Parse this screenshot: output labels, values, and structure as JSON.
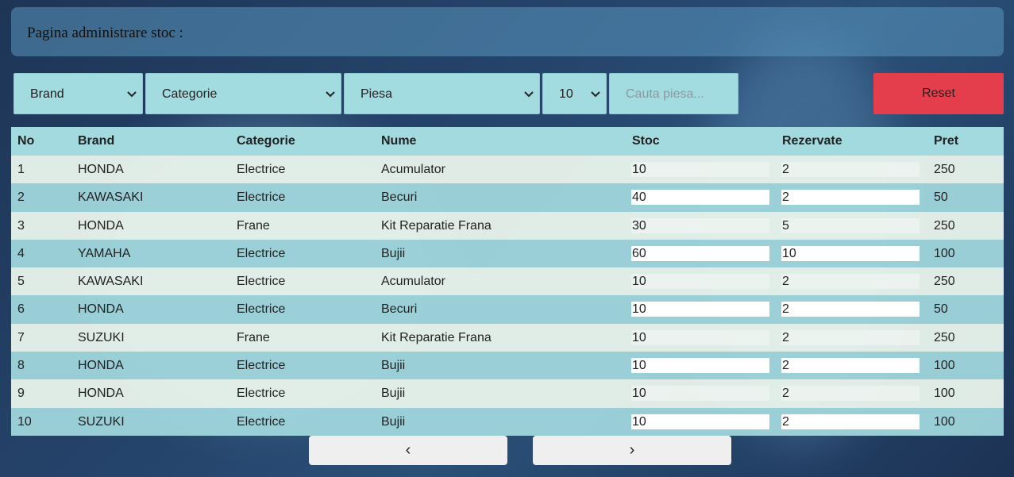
{
  "header": {
    "title": "Pagina administrare stoc :"
  },
  "filters": {
    "brand": "Brand",
    "categorie": "Categorie",
    "piesa": "Piesa",
    "per_page": "10",
    "search_placeholder": "Cauta piesa...",
    "reset_label": "Reset"
  },
  "table": {
    "columns": [
      "No",
      "Brand",
      "Categorie",
      "Nume",
      "Stoc",
      "Rezervate",
      "Pret"
    ],
    "rows": [
      {
        "no": "1",
        "brand": "HONDA",
        "categorie": "Electrice",
        "nume": "Acumulator",
        "stoc": "10",
        "rezervate": "2",
        "pret": "250"
      },
      {
        "no": "2",
        "brand": "KAWASAKI",
        "categorie": "Electrice",
        "nume": "Becuri",
        "stoc": "40",
        "rezervate": "2",
        "pret": "50"
      },
      {
        "no": "3",
        "brand": "HONDA",
        "categorie": "Frane",
        "nume": "Kit Reparatie Frana",
        "stoc": "30",
        "rezervate": "5",
        "pret": "250"
      },
      {
        "no": "4",
        "brand": "YAMAHA",
        "categorie": "Electrice",
        "nume": "Bujii",
        "stoc": "60",
        "rezervate": "10",
        "pret": "100"
      },
      {
        "no": "5",
        "brand": "KAWASAKI",
        "categorie": "Electrice",
        "nume": "Acumulator",
        "stoc": "10",
        "rezervate": "2",
        "pret": "250"
      },
      {
        "no": "6",
        "brand": "HONDA",
        "categorie": "Electrice",
        "nume": "Becuri",
        "stoc": "10",
        "rezervate": "2",
        "pret": "50"
      },
      {
        "no": "7",
        "brand": "SUZUKI",
        "categorie": "Frane",
        "nume": "Kit Reparatie Frana",
        "stoc": "10",
        "rezervate": "2",
        "pret": "250"
      },
      {
        "no": "8",
        "brand": "HONDA",
        "categorie": "Electrice",
        "nume": "Bujii",
        "stoc": "10",
        "rezervate": "2",
        "pret": "100"
      },
      {
        "no": "9",
        "brand": "HONDA",
        "categorie": "Electrice",
        "nume": "Bujii",
        "stoc": "10",
        "rezervate": "2",
        "pret": "100"
      },
      {
        "no": "10",
        "brand": "SUZUKI",
        "categorie": "Electrice",
        "nume": "Bujii",
        "stoc": "10",
        "rezervate": "2",
        "pret": "100"
      }
    ]
  },
  "pagination": {
    "prev": "‹",
    "next": "›"
  },
  "colors": {
    "reset_button": "#e43e4d",
    "filter_bg": "#a2dbe0",
    "page_bg": "#1e3556"
  }
}
